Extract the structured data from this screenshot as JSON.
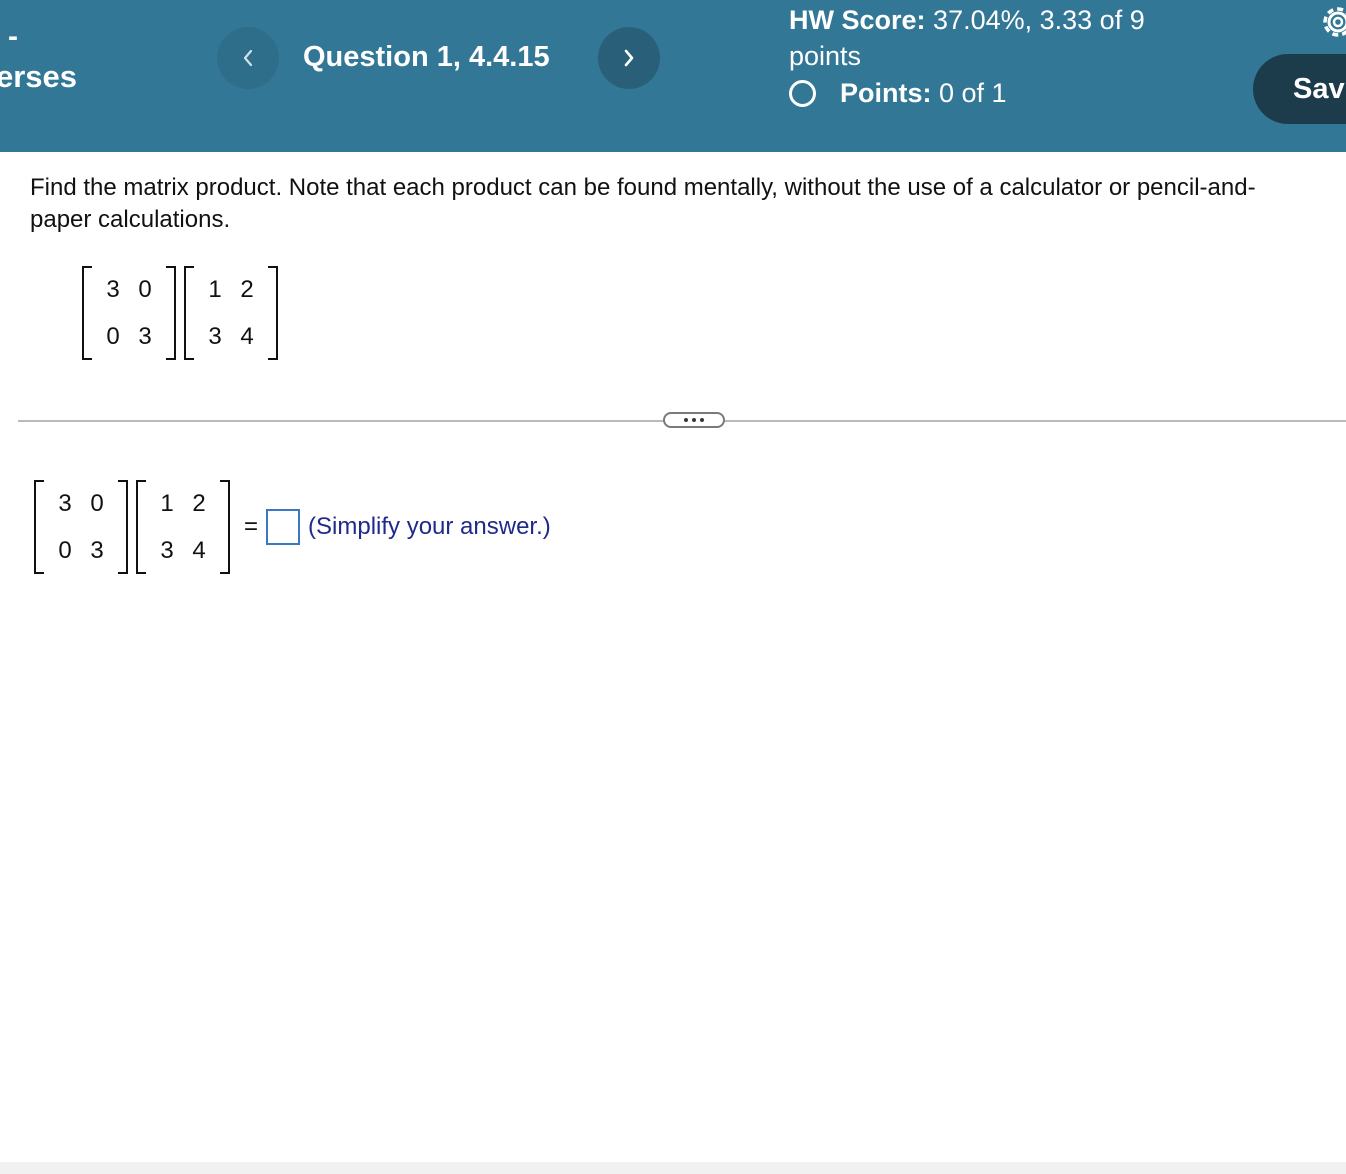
{
  "header": {
    "dash": "-",
    "assignment_title": "erses",
    "question_label": "Question 1, 4.4.15",
    "prev_glyph": "<",
    "next_glyph": ">",
    "score_label": "HW Score:",
    "score_value": "37.04%, 3.33 of 9",
    "score_unit": "points",
    "points_label": "Points:",
    "points_value": "0 of 1",
    "save_label": "Sav"
  },
  "question": {
    "prompt": "Find the matrix product. Note that each product can be found mentally, without the use of a calculator or pencil-and-paper calculations.",
    "matrix_a": [
      [
        "3",
        "0"
      ],
      [
        "0",
        "3"
      ]
    ],
    "matrix_b": [
      [
        "1",
        "2"
      ],
      [
        "3",
        "4"
      ]
    ]
  },
  "answer": {
    "equals": "=",
    "value": "",
    "hint": "(Simplify your answer.)"
  },
  "colors": {
    "header_bg": "#327795",
    "save_bg": "#1d3c4b",
    "hint_text": "#1f2a8a",
    "answer_border": "#3a78c2"
  },
  "icons": {
    "prev": "chevron-left-icon",
    "next": "chevron-right-icon",
    "status": "circle-icon",
    "settings": "gear-icon",
    "more": "ellipsis-icon"
  }
}
